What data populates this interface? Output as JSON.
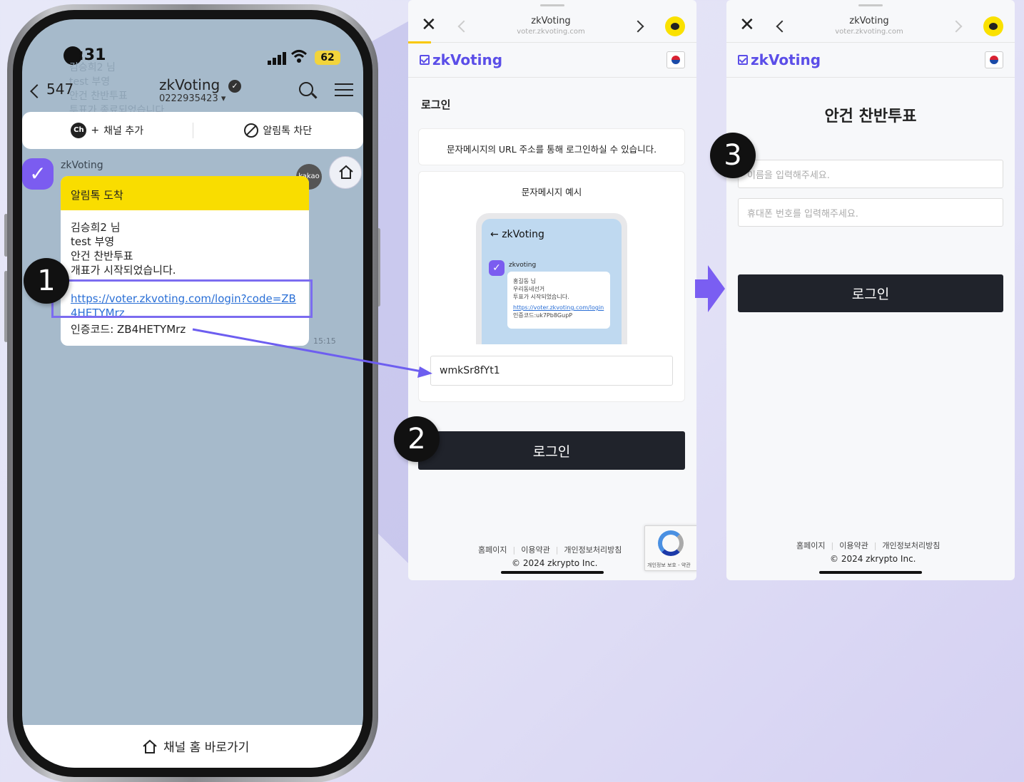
{
  "phone": {
    "status": {
      "time": ":31",
      "battery": "62"
    },
    "ghost_lines": [
      "김승희2 님",
      "test 부영",
      "안건 찬반투표",
      "투표가 종료되었습니다."
    ],
    "header": {
      "back_count": "547",
      "title": "zkVoting",
      "phone_number": "0222935423 ▾"
    },
    "actions": {
      "add_channel": "채널 추가",
      "block": "알림톡 차단",
      "ch_badge": "Ch"
    },
    "message": {
      "sender": "zkVoting",
      "badge": "kakao",
      "header": "알림톡 도착",
      "lines": [
        "김승희2 님",
        "test 부영",
        "안건 찬반투표",
        "개표가 시작되었습니다."
      ],
      "link": "https://voter.zkvoting.com/login?code=ZB4HETYMrz",
      "code_line": "인증코드: ZB4HETYMrz",
      "time": "15:15"
    },
    "bottom": {
      "label": "채널 홈 바로가기"
    }
  },
  "steps": [
    "1",
    "2",
    "3"
  ],
  "page2": {
    "browser": {
      "title": "zkVoting",
      "url": "voter.zkvoting.com"
    },
    "logo": "zkVoting",
    "section_title": "로그인",
    "info": "문자메시지의 URL 주소를 통해 로그인하실 수 있습니다.",
    "example_title": "문자메시지 예시",
    "example": {
      "title": "zkVoting",
      "sender": "zkvoting",
      "lines": [
        "홍길동 님",
        "우리동네선거",
        "투표가 시작되었습니다."
      ],
      "link": "https://voter.zkvoting.com/login",
      "code": "인증코드:uk7Pb8GupP"
    },
    "code_value": "wmkSr8fYt1",
    "login_button": "로그인",
    "footer": {
      "links": [
        "홈페이지",
        "이용약관",
        "개인정보처리방침"
      ],
      "copyright": "© 2024 zkrypto Inc."
    },
    "recaptcha": "개인정보 보호 - 약관"
  },
  "page3": {
    "browser": {
      "title": "zkVoting",
      "url": "voter.zkvoting.com"
    },
    "logo": "zkVoting",
    "title": "안건 찬반투표",
    "name_placeholder": "이름을 입력해주세요.",
    "phone_placeholder": "휴대폰 번호를 입력해주세요.",
    "login_button": "로그인",
    "footer": {
      "links": [
        "홈페이지",
        "이용약관",
        "개인정보처리방침"
      ],
      "copyright": "© 2024 zkrypto Inc."
    }
  },
  "colors": {
    "accent": "#7b6cf0",
    "kakao_yellow": "#f9dd00",
    "brand": "#5b4ee8",
    "button_dark": "#20232b"
  }
}
